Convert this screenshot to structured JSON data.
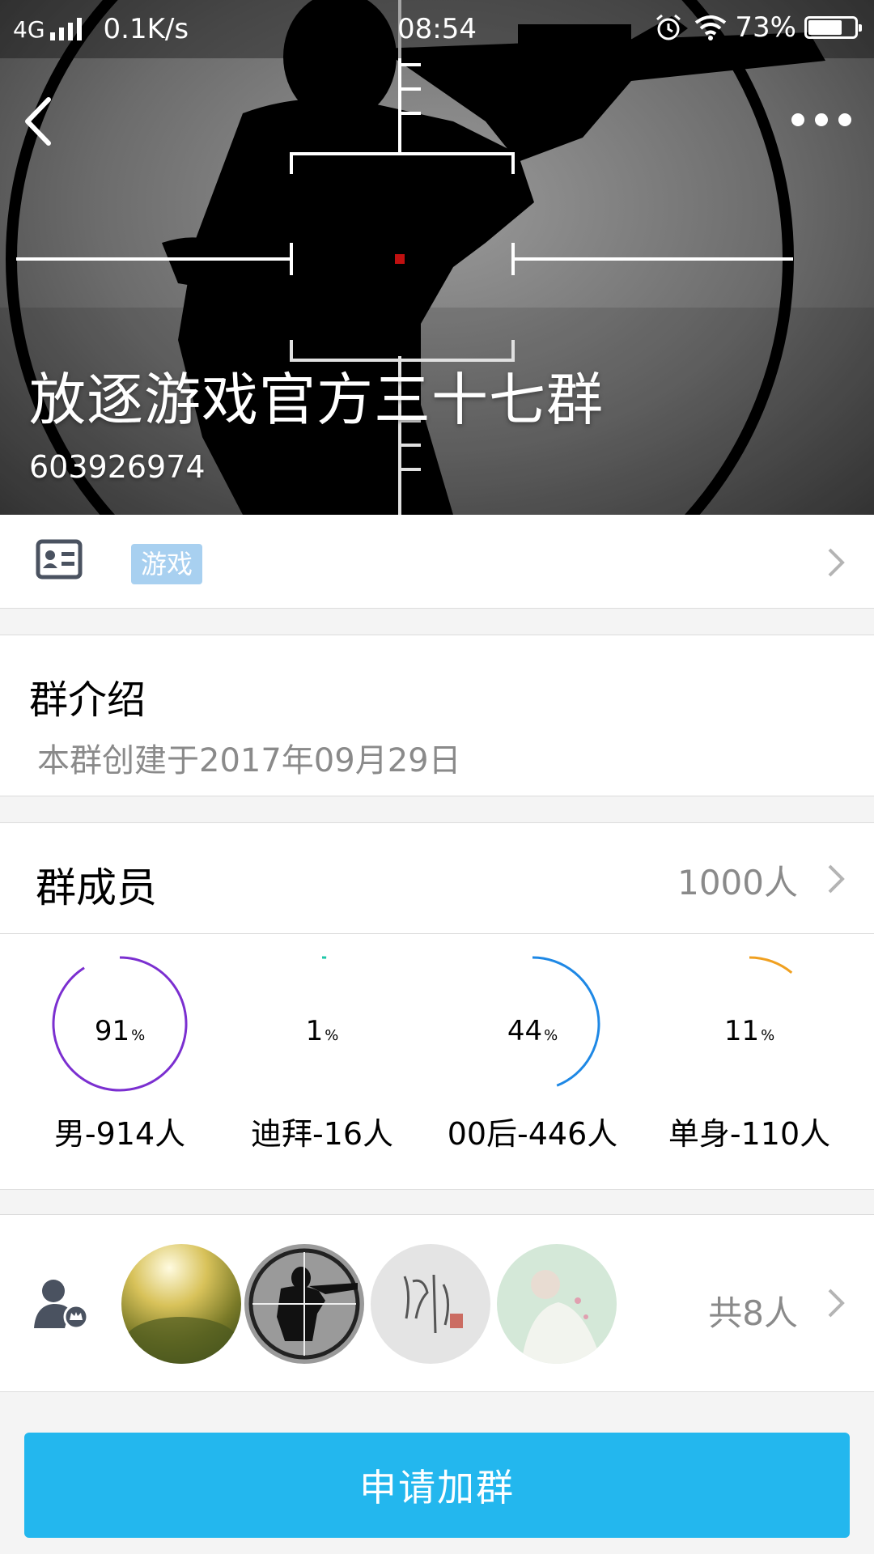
{
  "status_bar": {
    "network": "4G",
    "speed": "0.1K/s",
    "time": "08:54",
    "battery": "73%",
    "battery_level": 0.73
  },
  "header": {
    "group_name": "放逐游戏官方三十七群",
    "group_id": "603926974",
    "icons": [
      "back-icon",
      "more-icon"
    ]
  },
  "tag_row": {
    "icon": "id-card-icon",
    "tag": "游戏"
  },
  "intro": {
    "title": "群介绍",
    "text": "本群创建于2017年09月29日"
  },
  "members": {
    "title": "群成员",
    "count": "1000人",
    "stats": [
      {
        "value": "91",
        "unit": "%",
        "percent": 91,
        "label": "男-914人",
        "color": "#7b2fd0"
      },
      {
        "value": "1",
        "unit": "%",
        "percent": 1,
        "label": "迪拜-16人",
        "color": "#1fc7a8"
      },
      {
        "value": "44",
        "unit": "%",
        "percent": 44,
        "label": "00后-446人",
        "color": "#1e88e5"
      },
      {
        "value": "11",
        "unit": "%",
        "percent": 11,
        "label": "单身-110人",
        "color": "#f0a020"
      }
    ]
  },
  "admins": {
    "icon": "admin-user-icon",
    "count": "共8人"
  },
  "join_button": "申请加群",
  "colors": {
    "primary": "#23b7ee",
    "tag_bg": "#a8d0f0",
    "muted_text": "#8a8a8a"
  }
}
